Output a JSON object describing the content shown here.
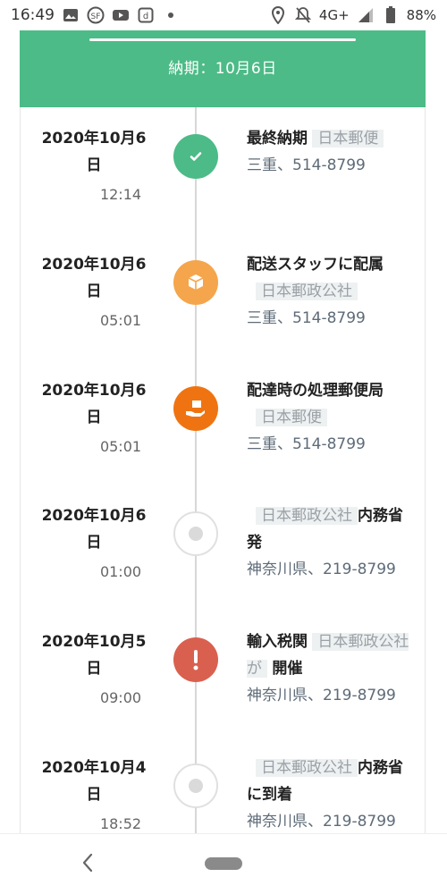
{
  "status_bar": {
    "time": "16:49",
    "network": "4G+",
    "battery": "88%",
    "icons": [
      "image-icon",
      "app-icon-sf",
      "youtube-icon",
      "app-icon-d",
      "dot-icon",
      "location-icon",
      "mute-icon",
      "signal-icon",
      "battery-icon"
    ]
  },
  "header": {
    "title": "納期：10月6日"
  },
  "events": [
    {
      "date": "2020年10月6日",
      "time": "12:14",
      "title": "最終納期",
      "carrier": "日本郵便",
      "location": "三重、514-8799",
      "icon": "check-icon",
      "color": "#4cbb87"
    },
    {
      "date": "2020年10月6日",
      "time": "05:01",
      "title": "配送スタッフに配属",
      "carrier": "日本郵政公社",
      "location": "三重、514-8799",
      "icon": "package-icon",
      "color": "#f5a54b"
    },
    {
      "date": "2020年10月6日",
      "time": "05:01",
      "title": "配達時の処理郵便局",
      "carrier": "日本郵便",
      "location": "三重、514-8799",
      "icon": "hand-package-icon",
      "color": "#ef7411"
    },
    {
      "date": "2020年10月6日",
      "time": "01:00",
      "carrier": "日本郵政公社",
      "title": "内務省発",
      "location": "神奈川県、219-8799",
      "icon": "dot-icon",
      "color": "#dadada"
    },
    {
      "date": "2020年10月5日",
      "time": "09:00",
      "title_before": "輸入税関",
      "carrier": "日本郵政公社が",
      "title_after": "開催",
      "location": "神奈川県、219-8799",
      "icon": "exclamation-icon",
      "color": "#d9604f"
    },
    {
      "date": "2020年10月4日",
      "time": "18:52",
      "carrier": "日本郵政公社",
      "title": "内務省に到着",
      "location": "神奈川県、219-8799",
      "icon": "dot-icon",
      "color": "#dadada"
    }
  ]
}
